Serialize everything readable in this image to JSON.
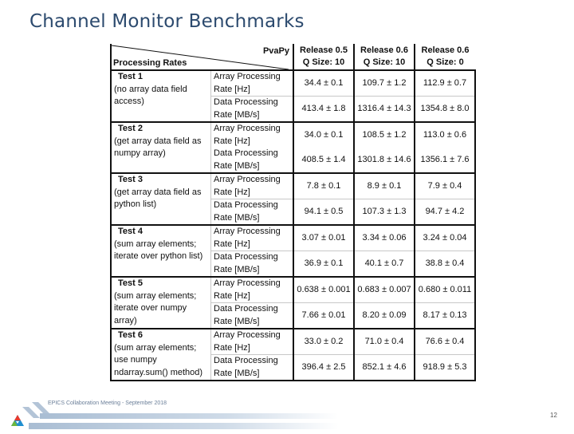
{
  "slide": {
    "title": "Channel Monitor Benchmarks",
    "footer_text": "EPICS Collaboration Meeting - September 2018",
    "page_number": "12"
  },
  "table": {
    "corner_top": "PvaPy",
    "corner_bottom": "Processing Rates",
    "columns": [
      {
        "line1": "Release 0.5",
        "line2": "Q Size: 10"
      },
      {
        "line1": "Release 0.6",
        "line2": "Q Size: 10"
      },
      {
        "line1": "Release 0.6",
        "line2": "Q Size: 0"
      }
    ],
    "metrics": {
      "array_l1": "Array Processing",
      "array_l2": "Rate [Hz]",
      "data_l1": "Data Processing",
      "data_l2": "Rate [MB/s]"
    },
    "tests": [
      {
        "name": "Test 1",
        "desc": [
          "(no array data field",
          "access)"
        ],
        "array_rate": [
          "34.4 ± 0.1",
          "109.7 ± 1.2",
          "112.9 ± 0.7"
        ],
        "data_rate": [
          "413.4 ± 1.8",
          "1316.4 ± 14.3",
          "1354.8 ± 8.0"
        ]
      },
      {
        "name": "Test 2",
        "desc": [
          "(get array data field as",
          "numpy array)"
        ],
        "array_rate": [
          "34.0 ± 0.1",
          "108.5 ± 1.2",
          "113.0 ± 0.6"
        ],
        "data_rate": [
          "408.5 ± 1.4",
          "1301.8 ± 14.6",
          "1356.1 ± 7.6"
        ]
      },
      {
        "name": "Test 3",
        "desc": [
          "(get array data field as",
          "python list)"
        ],
        "array_rate": [
          "7.8 ± 0.1",
          "8.9 ± 0.1",
          "7.9 ± 0.4"
        ],
        "data_rate": [
          "94.1 ± 0.5",
          "107.3 ± 1.3",
          "94.7 ± 4.2"
        ]
      },
      {
        "name": "Test 4",
        "desc": [
          "(sum array elements;",
          "iterate over python list)"
        ],
        "array_rate": [
          "3.07 ± 0.01",
          "3.34 ± 0.06",
          "3.24 ± 0.04"
        ],
        "data_rate": [
          "36.9 ± 0.1",
          "40.1 ± 0.7",
          "38.8 ± 0.4"
        ]
      },
      {
        "name": "Test 5",
        "desc": [
          "(sum array elements;",
          "iterate over numpy",
          "array)"
        ],
        "array_rate": [
          "0.638 ± 0.001",
          "0.683 ± 0.007",
          "0.680 ± 0.011"
        ],
        "data_rate": [
          "7.66 ± 0.01",
          "8.20 ± 0.09",
          "8.17 ± 0.13"
        ]
      },
      {
        "name": "Test 6",
        "desc": [
          "(sum array elements;",
          "use numpy",
          "ndarray.sum() method)"
        ],
        "array_rate": [
          "33.0 ± 0.2",
          "71.0 ± 0.4",
          "76.6 ± 0.4"
        ],
        "data_rate": [
          "396.4 ± 2.5",
          "852.1 ± 4.6",
          "918.9 ± 5.3"
        ]
      }
    ]
  }
}
